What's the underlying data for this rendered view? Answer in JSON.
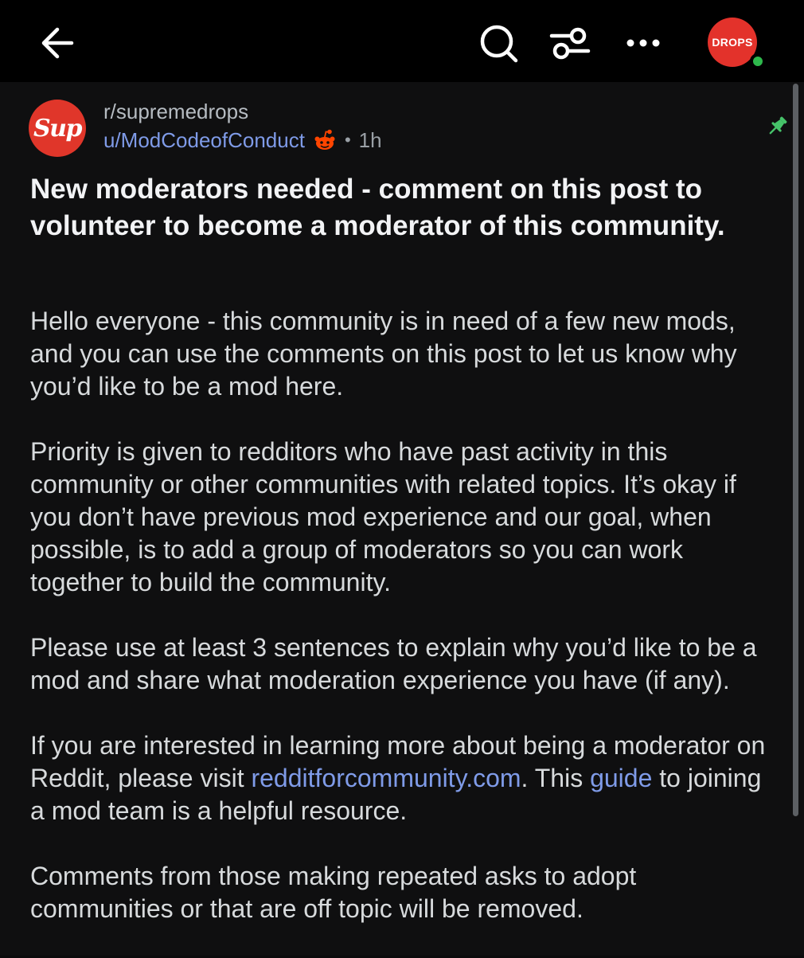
{
  "header": {
    "back_icon": "back-arrow-icon",
    "search_icon": "search-icon",
    "filter_icon": "sort-filter-icon",
    "more_icon": "more-horizontal-icon",
    "user_avatar_text": "DROPS",
    "online_status_color": "#2eb84c"
  },
  "post": {
    "subreddit": "r/supremedrops",
    "subreddit_avatar_text": "Sup",
    "author": "u/ModCodeofConduct",
    "time_ago": "1h",
    "pinned": true,
    "title": "New moderators needed - comment on this post to volunteer to become a moderator of this community.",
    "body": {
      "p1": "Hello everyone - this community is in need of a few new mods, and you can use the comments on this post to let us know why you’d like to be a mod here.",
      "p2": "Priority is given to redditors who have past activity in this community or other communities with related topics. It’s okay if you don’t have previous mod experience and our goal, when possible, is to add a group of moderators so you can work together to build the community.",
      "p3": "Please use at least 3 sentences to explain why you’d like to be a mod and share what moderation experience you have (if any).",
      "p4_before": "If you are interested in learning more about being a moderator on Reddit, please visit ",
      "p4_link": "redditforcommunity.com",
      "p4_middle": ". This ",
      "p4_guide_link": "guide",
      "p4_after": " to joining a mod team is a helpful resource.",
      "p5": "Comments from those making repeated asks to adopt communities or that are off topic will be removed."
    }
  },
  "colors": {
    "background": "#0f0f10",
    "topbar": "#000000",
    "link": "#7f9be8",
    "accent_red": "#e3322b",
    "pin_green": "#46c36a"
  }
}
